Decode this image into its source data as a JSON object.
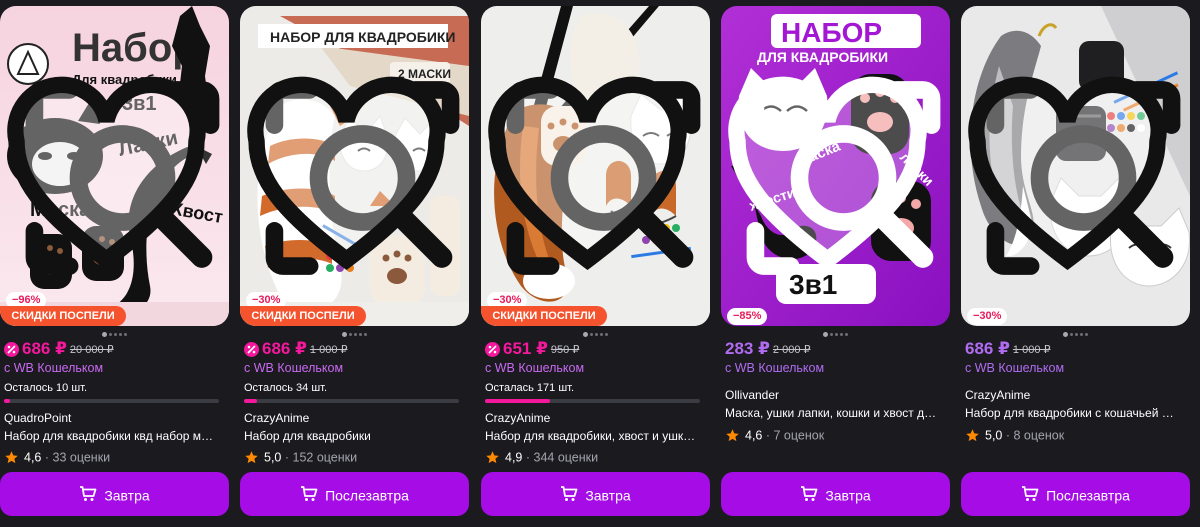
{
  "colors": {
    "accent": "#a60de6",
    "price_pink": "#f3189c",
    "price_violet": "#b06cf0",
    "promo": "#f5532e"
  },
  "icons": {
    "find_similar": "image-search-icon",
    "favorite": "heart-icon",
    "cart": "cart-icon",
    "rating": "star-icon",
    "wallet": "wb-wallet-badge-icon"
  },
  "products": [
    {
      "image_texts": [
        "Набор",
        "Для квадробики",
        "3в1",
        "Лапки",
        "Маска",
        "Хвост"
      ],
      "discount": "−96%",
      "promo": "СКИДКИ ПОСПЕЛИ",
      "price": "686 ₽",
      "old_price": "20 000 ₽",
      "wallet": "с WB Кошельком",
      "stock": "Осталось 10 шт.",
      "stock_level_pct": 3,
      "brand": "QuadroPoint",
      "name": "Набор для квадробики квд набор маска лапки хвост",
      "rating": "4,6",
      "reviews": "33 оценки",
      "button": "Завтра"
    },
    {
      "image_texts": [
        "НАБОР ДЛЯ КВАДРОБИКИ",
        "2 МАСКИ"
      ],
      "discount": "−30%",
      "promo": "СКИДКИ ПОСПЕЛИ",
      "price": "686 ₽",
      "old_price": "1 000 ₽",
      "wallet": "с WB Кошельком",
      "stock": "Осталось 34 шт.",
      "stock_level_pct": 6,
      "brand": "CrazyAnime",
      "name": "Набор для квадробики",
      "rating": "5,0",
      "reviews": "152 оценки",
      "button": "Послезавтра"
    },
    {
      "image_texts": [],
      "discount": "−30%",
      "promo": "СКИДКИ ПОСПЕЛИ",
      "price": "651 ₽",
      "old_price": "950 ₽",
      "wallet": "с WB Кошельком",
      "stock": "Осталась 171 шт.",
      "stock_level_pct": 30,
      "brand": "CrazyAnime",
      "name": "Набор для квадробики, хвост и ушки для костюма",
      "rating": "4,9",
      "reviews": "344 оценки",
      "button": "Завтра"
    },
    {
      "image_texts": [
        "НАБОР",
        "ДЛЯ КВАДРОБИКИ",
        "маска",
        "хвостик",
        "лапки",
        "3в1"
      ],
      "discount": "−85%",
      "price": "283 ₽",
      "old_price": "2 000 ₽",
      "wallet": "с WB Кошельком",
      "brand": "Ollivander",
      "name": "Маска, ушки лапки, кошки и хвост для квадробики",
      "rating": "4,6",
      "reviews": "7 оценок",
      "button": "Завтра"
    },
    {
      "image_texts": [],
      "discount": "−30%",
      "price": "686 ₽",
      "old_price": "1 000 ₽",
      "wallet": "с WB Кошельком",
      "brand": "CrazyAnime",
      "name": "Набор для квадробики с кошачьей маской и хвостом",
      "rating": "5,0",
      "reviews": "8 оценок",
      "button": "Послезавтра"
    }
  ]
}
